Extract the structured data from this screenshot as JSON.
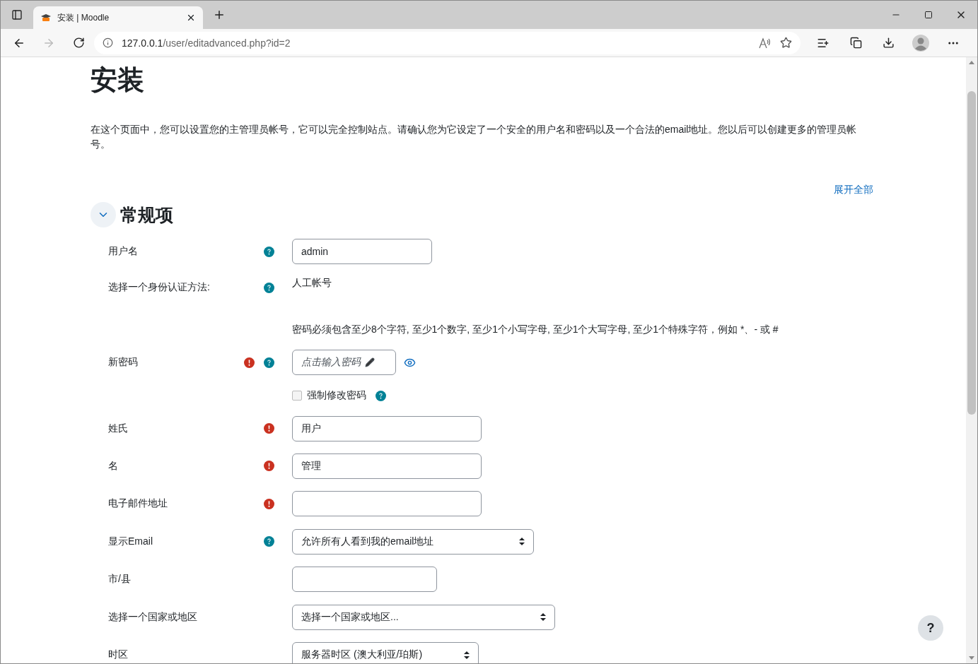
{
  "browser": {
    "tab_title": "安装 | Moodle",
    "url_host": "127.0.0.1",
    "url_path": "/user/editadvanced.php?id=2"
  },
  "page": {
    "title": "安装",
    "intro": "在这个页面中，您可以设置您的主管理员帐号，它可以完全控制站点。请确认您为它设定了一个安全的用户名和密码以及一个合法的email地址。您以后可以创建更多的管理员帐号。",
    "expand_all": "展开全部",
    "section": {
      "title": "常规项",
      "expanded": true
    },
    "rows": [
      {
        "kind": "text",
        "label": "用户名",
        "required": false,
        "help": true,
        "value": "admin"
      },
      {
        "kind": "static",
        "label": "选择一个身份认证方法:",
        "required": false,
        "help": true,
        "value": "人工帐号"
      },
      {
        "kind": "note",
        "value": "密码必须包含至少8个字符, 至少1个数字, 至少1个小写字母, 至少1个大写字母, 至少1个特殊字符，例如 *、- 或 #"
      },
      {
        "kind": "password",
        "label": "新密码",
        "required": true,
        "help": true,
        "placeholder": "点击输入密码"
      },
      {
        "kind": "checkbox",
        "label": "强制修改密码",
        "checked": false,
        "help": true
      },
      {
        "kind": "text",
        "label": "姓氏",
        "required": true,
        "help": false,
        "value": "用户"
      },
      {
        "kind": "text",
        "label": "名",
        "required": true,
        "help": false,
        "value": "管理"
      },
      {
        "kind": "text",
        "label": "电子邮件地址",
        "required": true,
        "help": false,
        "value": ""
      },
      {
        "kind": "select",
        "label": "显示Email",
        "required": false,
        "help": true,
        "value": "允许所有人看到我的email地址"
      },
      {
        "kind": "text",
        "label": "市/县",
        "required": false,
        "help": false,
        "value": ""
      },
      {
        "kind": "select",
        "label": "选择一个国家或地区",
        "required": false,
        "help": false,
        "value": "选择一个国家或地区..."
      },
      {
        "kind": "select",
        "label": "时区",
        "required": false,
        "help": false,
        "value": "服务器时区 (澳大利亚/珀斯)"
      }
    ],
    "help_button": "?"
  }
}
